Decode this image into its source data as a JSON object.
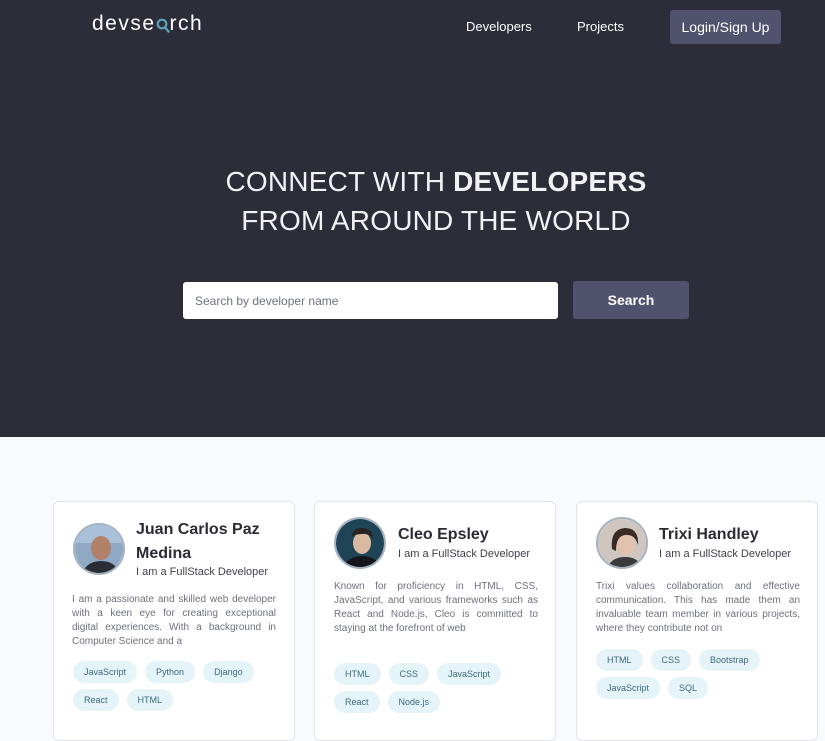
{
  "header": {
    "logo_pre": "devse",
    "logo_post": "rch",
    "nav": [
      "Developers",
      "Projects"
    ],
    "login_label": "Login/Sign Up"
  },
  "hero": {
    "line1_pre": "CONNECT WITH ",
    "line1_bold": "DEVELOPERS",
    "line2": "FROM AROUND THE WORLD",
    "search_placeholder": "Search by developer name",
    "search_label": "Search"
  },
  "developers": [
    {
      "name": "Juan Carlos Paz Medina",
      "role": "I am a FullStack Developer",
      "bio": "I am a passionate and skilled web developer with a keen eye for creating exceptional digital experiences. With a background in Computer Science and a",
      "skills": [
        "JavaScript",
        "Python",
        "Django",
        "React",
        "HTML"
      ]
    },
    {
      "name": "Cleo Epsley",
      "role": "I am a FullStack Developer",
      "bio": "Known for proficiency in HTML, CSS, JavaScript, and various frameworks such as React and Node.js, Cleo is committed to staying at the forefront of web",
      "skills": [
        "HTML",
        "CSS",
        "JavaScript",
        "React",
        "Node.js"
      ]
    },
    {
      "name": "Trixi Handley",
      "role": "I am a FullStack Developer",
      "bio": "Trixi values collaboration and effective communication. This has made them an invaluable team member in various projects, where they contribute not on",
      "skills": [
        "HTML",
        "CSS",
        "Bootstrap",
        "JavaScript",
        "SQL"
      ]
    }
  ],
  "colors": {
    "header_bg": "#2d2d39",
    "accent": "#51536e",
    "logo_accent": "#5aa0b8",
    "tag_bg": "#e5f4f8",
    "tag_text": "#3c6a80"
  }
}
